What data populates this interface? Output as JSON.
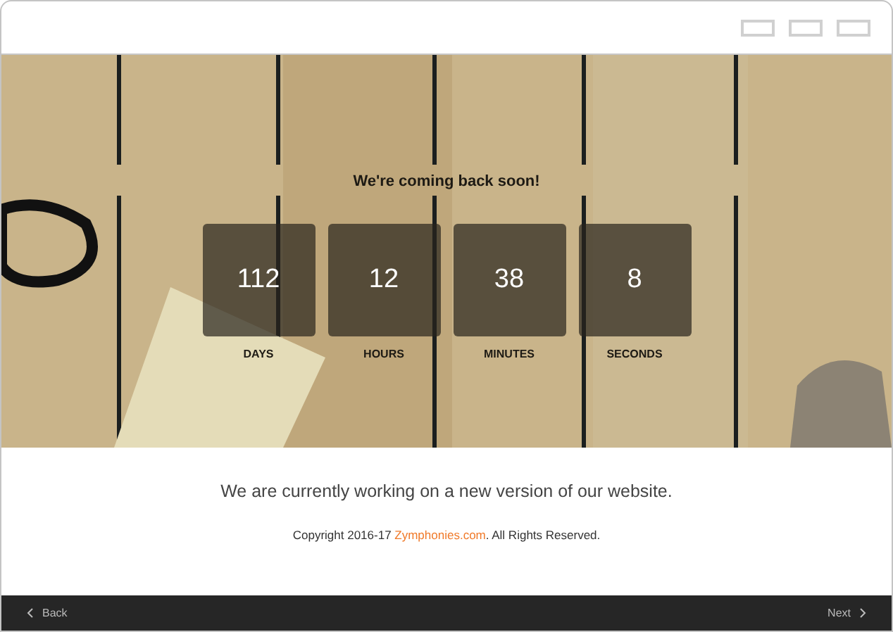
{
  "hero": {
    "headline": "We're coming back soon!",
    "countdown": [
      {
        "value": "112",
        "unit": "DAYS"
      },
      {
        "value": "12",
        "unit": "HOURS"
      },
      {
        "value": "38",
        "unit": "MINUTES"
      },
      {
        "value": "8",
        "unit": "SECONDS"
      }
    ]
  },
  "message": "We are currently working on a new version of our website.",
  "copyright": {
    "before": "Copyright 2016-17 ",
    "link": "Zymphonies.com",
    "after": ". All Rights Reserved."
  },
  "nav": {
    "back": "Back",
    "next": "Next"
  }
}
